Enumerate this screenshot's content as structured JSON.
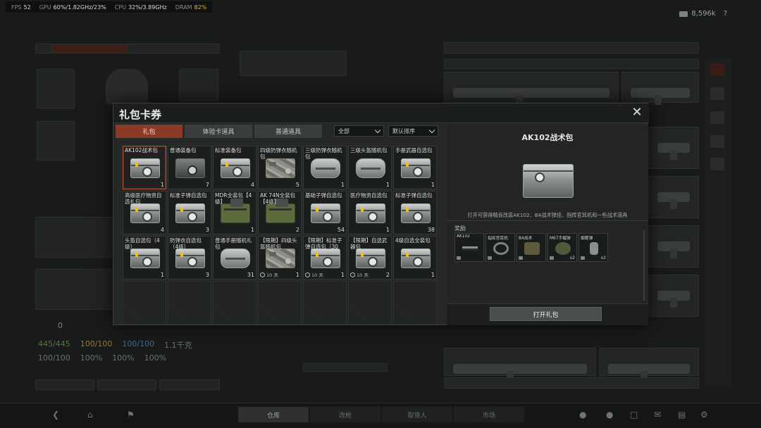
{
  "perf": {
    "fps_label": "FPS",
    "fps": "52",
    "gpu_label": "GPU",
    "gpu": "60%/1.82GHz/23%",
    "cpu_label": "CPU",
    "cpu": "32%/3.89GHz",
    "dram_label": "DRAM",
    "dram": "82%"
  },
  "currency": {
    "amount": "8,596k",
    "help": "?"
  },
  "modal": {
    "title": "礼包卡券",
    "close": "✕",
    "tabs": [
      {
        "label": "礼包"
      },
      {
        "label": "体验卡道具"
      },
      {
        "label": "普通道具"
      }
    ],
    "filter": {
      "value": "全部"
    },
    "sort": {
      "value": "默认排序"
    },
    "items": [
      {
        "name": "AK102战术包",
        "count": "1",
        "art": "steel"
      },
      {
        "name": "普通装备包",
        "count": "7",
        "art": "dark"
      },
      {
        "name": "标准装备包",
        "count": "4",
        "art": "steel"
      },
      {
        "name": "四级防弹衣随机包",
        "count": "5",
        "art": "camo"
      },
      {
        "name": "三级防弹衣随机包",
        "count": "1",
        "art": "drum"
      },
      {
        "name": "三级头盔随机包",
        "count": "1",
        "art": "drum"
      },
      {
        "name": "手册武器自选包",
        "count": "1",
        "art": "steel"
      },
      {
        "name": "高级医疗物资自选礼包",
        "count": "4",
        "art": "steel"
      },
      {
        "name": "标准子弹自选包",
        "count": "3",
        "art": "steel"
      },
      {
        "name": "MDR全装包【4级】",
        "count": "1",
        "art": "crate"
      },
      {
        "name": "AK 74N全装包【4级】",
        "count": "2",
        "art": "crate"
      },
      {
        "name": "基础子弹自选包",
        "count": "54",
        "art": "steel"
      },
      {
        "name": "医疗物资自选包",
        "count": "1",
        "art": "steel"
      },
      {
        "name": "标准子弹自选包",
        "count": "38",
        "art": "steel"
      },
      {
        "name": "头盔自选包（4级）",
        "count": "1",
        "art": "steel"
      },
      {
        "name": "防弹衣自选包（4级）",
        "count": "3",
        "art": "steel"
      },
      {
        "name": "普通手册随机礼包",
        "count": "31",
        "art": "drum"
      },
      {
        "name": "【限期】四级头盔随机包",
        "count": "1",
        "art": "camo",
        "timer": "10 天"
      },
      {
        "name": "【限期】标准子弹自选包（30发）",
        "count": "1",
        "art": "steel",
        "timer": "10 天"
      },
      {
        "name": "【限期】自选武器包",
        "count": "2",
        "art": "steel",
        "timer": "10 天"
      },
      {
        "name": "4级自选全装包",
        "count": "1",
        "art": "steel"
      }
    ],
    "detail": {
      "title": "AK102战术包",
      "description": "打开可获得精良改装AK102、B4战术弹挂、指挥官耳机和一些战术道具",
      "rewards_label": "奖励",
      "rewards": [
        {
          "name": "AK102",
          "count": ""
        },
        {
          "name": "指挥官耳机",
          "count": ""
        },
        {
          "name": "B4战术",
          "count": ""
        },
        {
          "name": "M67手榴弹",
          "count": "x2"
        },
        {
          "name": "烟雾弹",
          "count": "x2"
        }
      ],
      "open_button": "打开礼包"
    }
  },
  "background": {
    "stats": {
      "hp": "445/445",
      "energy": "100/100",
      "water": "100/100",
      "weight": "1.1千克",
      "a": "100/100",
      "b": "100%",
      "c": "100%",
      "d": "100%"
    },
    "safe_box_value": "0",
    "bottom_tabs": [
      "仓库",
      "改枪",
      "取货人",
      "市场"
    ]
  }
}
